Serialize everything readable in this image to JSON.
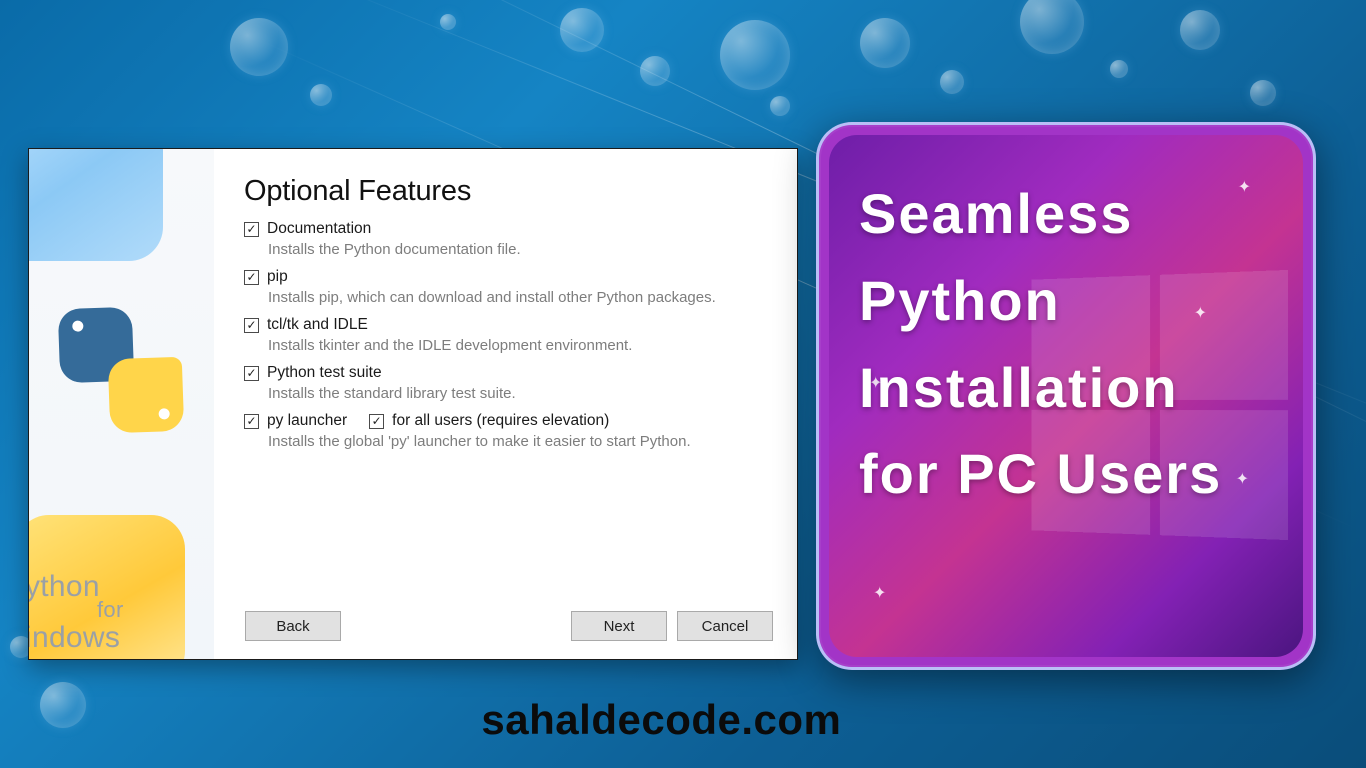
{
  "installer": {
    "title": "Optional Features",
    "features": [
      {
        "label": "Documentation",
        "desc": "Installs the Python documentation file."
      },
      {
        "label": "pip",
        "desc": "Installs pip, which can download and install other Python packages."
      },
      {
        "label": "tcl/tk and IDLE",
        "desc": "Installs tkinter and the IDLE development environment."
      },
      {
        "label": "Python test suite",
        "desc": "Installs the standard library test suite."
      }
    ],
    "launcher": {
      "label": "py launcher",
      "all_users_label": "for all users (requires elevation)",
      "desc": "Installs the global 'py' launcher to make it easier to start Python."
    },
    "buttons": {
      "back": "Back",
      "next": "Next",
      "cancel": "Cancel"
    },
    "side": {
      "line1": "ython",
      "for": "for",
      "line2": "indows"
    }
  },
  "promo": {
    "line1": "Seamless",
    "line2": "Python",
    "line3": "Installation",
    "line4": "for PC Users"
  },
  "footer": {
    "url": "sahaldecode.com"
  }
}
